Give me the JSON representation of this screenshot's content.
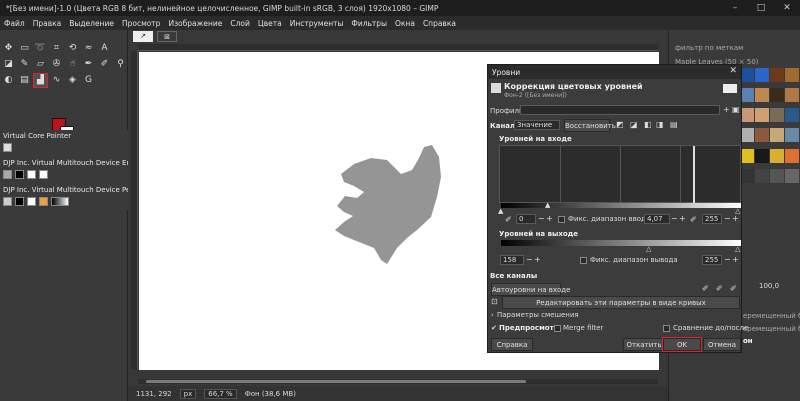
{
  "window": {
    "title": "*[Без имени]-1.0 (Цвета RGB 8 бит, нелинейное целочисленное, GIMP built-in sRGB, 3 слоя) 1920x1080 – GIMP",
    "minimize": "–",
    "maximize": "□",
    "close": "✕"
  },
  "menu": [
    "Файл",
    "Правка",
    "Выделение",
    "Просмотр",
    "Изображение",
    "Слой",
    "Цвета",
    "Инструменты",
    "Фильтры",
    "Окна",
    "Справка"
  ],
  "devices": {
    "items": [
      {
        "label": "Virtual Core Pointer"
      },
      {
        "label": "DJP Inc. Virtual Multitouch Device Er..."
      },
      {
        "label": "DJP Inc. Virtual Multitouch Device Pe..."
      }
    ]
  },
  "right_panel": {
    "filter_placeholder": "фильтр по меткам",
    "brush_name": "Maple Leaves (50 × 50)",
    "opacity_value": "100,0",
    "layer_rows": [
      "еремещенный бу",
      "еремещенный бу",
      "он"
    ]
  },
  "statusbar": {
    "coords": "1131, 292",
    "unit": "px",
    "zoom": "66,7 %",
    "layer_info": "Фон (38,6 MB)"
  },
  "levels_dialog": {
    "window_title": "Уровни",
    "heading": "Коррекция цветовых уровней",
    "subheading": "Фон-2 ([Без имени])",
    "presets_label": "Профили:",
    "channel_label": "Канал:",
    "channel_value": "Значение",
    "reset_channel": "Восстановить",
    "input_levels_label": "Уровней на входе",
    "input_low": "0",
    "clamp_input": "Фикс. диапазон ввода",
    "gamma": "4,07",
    "input_high": "255",
    "output_levels_label": "Уровней на выходе",
    "output_low": "158",
    "clamp_output": "Фикс. диапазон вывода",
    "output_high": "255",
    "all_channels_label": "Все каналы",
    "auto_input": "Автоуровни на входе",
    "edit_as_curves": "Редактировать эти параметры в виде кривых",
    "blending_options": "Параметры смешения",
    "preview": "Предпросмотр",
    "preview_checked": true,
    "merge_filter": "Merge filter",
    "split_view": "Сравнение до/после",
    "help": "Справка",
    "reset": "Откатить",
    "ok": "OK",
    "cancel": "Отмена"
  },
  "colors": {
    "accent_red": "#d8262d",
    "foreground": "#c0101e",
    "background": "#fafafa"
  }
}
